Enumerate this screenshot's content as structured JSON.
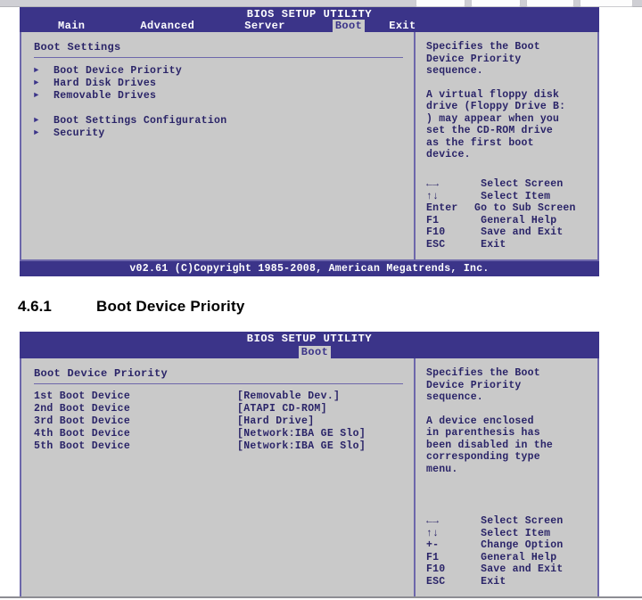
{
  "host_chrome": {
    "toolbar_chips": [
      "chip-1",
      "chip-2",
      "chip-3",
      "chip-4"
    ]
  },
  "screen_one": {
    "title": "BIOS SETUP UTILITY",
    "tabs": [
      {
        "label": "Main",
        "active": false
      },
      {
        "label": "Advanced",
        "active": false
      },
      {
        "label": "Server",
        "active": false
      },
      {
        "label": "Boot",
        "active": true
      },
      {
        "label": "Exit",
        "active": false
      }
    ],
    "section_title": "Boot Settings",
    "menu_items": [
      {
        "label": "Boot Device Priority",
        "icon": "triangle-right-icon"
      },
      {
        "label": "Hard Disk Drives",
        "icon": "triangle-right-icon"
      },
      {
        "label": "Removable Drives",
        "icon": "triangle-right-icon"
      },
      {
        "label": "Boot Settings Configuration",
        "icon": "triangle-right-icon"
      },
      {
        "label": "Security",
        "icon": "triangle-right-icon"
      }
    ],
    "help_paragraph_1": "Specifies the Boot\nDevice Priority\nsequence.",
    "help_paragraph_2": "A virtual floppy disk\ndrive (Floppy Drive B:\n) may appear when you\nset the CD-ROM drive\nas the first boot\ndevice.",
    "nav_keys": [
      {
        "key": "←→",
        "desc": " Select Screen"
      },
      {
        "key": "↑↓",
        "desc": " Select Item"
      },
      {
        "key": "Enter",
        "desc": "Go to Sub Screen"
      },
      {
        "key": "F1",
        "desc": " General Help"
      },
      {
        "key": "F10",
        "desc": " Save and Exit"
      },
      {
        "key": "ESC",
        "desc": " Exit"
      }
    ],
    "footer": "v02.61 (C)Copyright 1985-2008, American Megatrends, Inc."
  },
  "doc_heading": {
    "number": "4.6.1",
    "text": "Boot Device Priority"
  },
  "screen_two": {
    "title": "BIOS SETUP UTILITY",
    "tabs": [
      {
        "label": "Boot",
        "active": true
      }
    ],
    "section_title": "Boot Device Priority",
    "devices": [
      {
        "name": "1st Boot Device",
        "value": "[Removable Dev.]"
      },
      {
        "name": "2nd Boot Device",
        "value": "[ATAPI CD-ROM]"
      },
      {
        "name": "3rd Boot Device",
        "value": "[Hard Drive]"
      },
      {
        "name": "4th Boot Device",
        "value": "[Network:IBA GE Slo]"
      },
      {
        "name": "5th Boot Device",
        "value": "[Network:IBA GE Slo]"
      }
    ],
    "help_paragraph_1": "Specifies the Boot\nDevice Priority\nsequence.",
    "help_paragraph_2": "A device enclosed\nin parenthesis has\nbeen disabled in the\ncorresponding type\nmenu.",
    "nav_keys": [
      {
        "key": "←→",
        "desc": " Select Screen"
      },
      {
        "key": "↑↓",
        "desc": " Select Item"
      },
      {
        "key": "+-",
        "desc": " Change Option"
      },
      {
        "key": "F1",
        "desc": " General Help"
      },
      {
        "key": "F10",
        "desc": " Save and Exit"
      },
      {
        "key": "ESC",
        "desc": " Exit"
      }
    ]
  },
  "colors": {
    "bios_blue": "#3b3489",
    "panel_gray": "#c9c9c9",
    "text_indigo": "#2a2468",
    "border_violet": "#6d67ab"
  }
}
